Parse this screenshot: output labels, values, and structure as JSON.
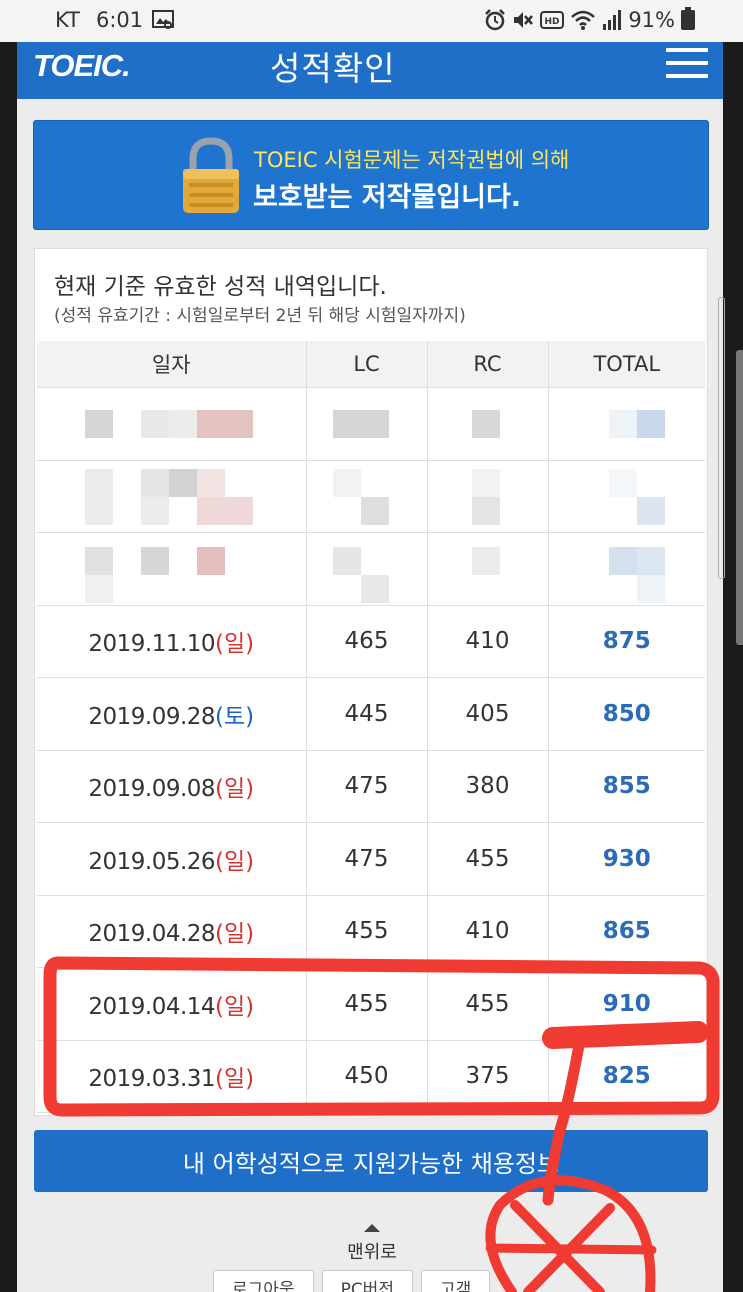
{
  "status_bar": {
    "carrier": "KT",
    "time": "6:01",
    "battery": "91%",
    "icons": [
      "gallery-icon",
      "alarm-icon",
      "mute-icon",
      "hd-icon",
      "wifi-icon",
      "signal-icon",
      "battery-icon"
    ]
  },
  "header": {
    "logo": "TOEIC.",
    "title": "성적확인",
    "menu_icon": "hamburger-icon"
  },
  "banner": {
    "line1": "TOEIC 시험문제는 저작권법에 의해",
    "line2": "보호받는 저작물입니다.",
    "icon": "padlock-icon"
  },
  "panel": {
    "title": "현재 기준 유효한 성적 내역입니다.",
    "note": "(성적 유효기간 : 시험일로부터 2년 뒤 해당 시험일자까지)"
  },
  "table": {
    "columns": [
      "일자",
      "LC",
      "RC",
      "TOTAL"
    ],
    "rows": [
      {
        "date": "2019.11.10",
        "day": "(일)",
        "lc": "465",
        "rc": "410",
        "total": "875"
      },
      {
        "date": "2019.09.28",
        "day": "(토)",
        "lc": "445",
        "rc": "405",
        "total": "850"
      },
      {
        "date": "2019.09.08",
        "day": "(일)",
        "lc": "475",
        "rc": "380",
        "total": "855"
      },
      {
        "date": "2019.05.26",
        "day": "(일)",
        "lc": "475",
        "rc": "455",
        "total": "930"
      },
      {
        "date": "2019.04.28",
        "day": "(일)",
        "lc": "455",
        "rc": "410",
        "total": "865"
      },
      {
        "date": "2019.04.14",
        "day": "(일)",
        "lc": "455",
        "rc": "455",
        "total": "910"
      },
      {
        "date": "2019.03.31",
        "day": "(일)",
        "lc": "450",
        "rc": "375",
        "total": "825"
      }
    ]
  },
  "cta": {
    "label": "내 어학성적으로 지원가능한 채용정보"
  },
  "scroll_top": {
    "label": "맨위로"
  },
  "footer": {
    "logout": "로그아웃",
    "pc_version": "PC버전",
    "notice": "고객"
  },
  "colors": {
    "brand_blue": "#1f6ec7",
    "total_blue": "#2a6cb8",
    "sunday_red": "#d5332f",
    "saturday_blue": "#1c62c5",
    "banner_yellow": "#ffe55c",
    "annotation_red": "#ef3b32"
  }
}
